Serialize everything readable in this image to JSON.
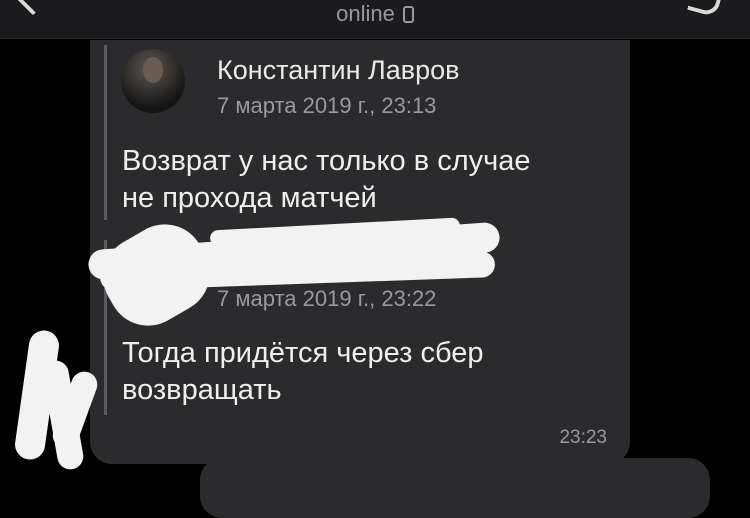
{
  "header": {
    "status": "online"
  },
  "message": {
    "forwarded": [
      {
        "author": "Константин Лавров",
        "date": "7 марта 2019 г., 23:13",
        "text_lines": [
          "Возврат у нас только в случае",
          "не прохода матчей"
        ]
      },
      {
        "author": "",
        "date": "7 марта 2019 г., 23:22",
        "text_lines": [
          "Тогда придётся через сбер",
          "возвращать"
        ]
      }
    ],
    "time": "23:23"
  }
}
